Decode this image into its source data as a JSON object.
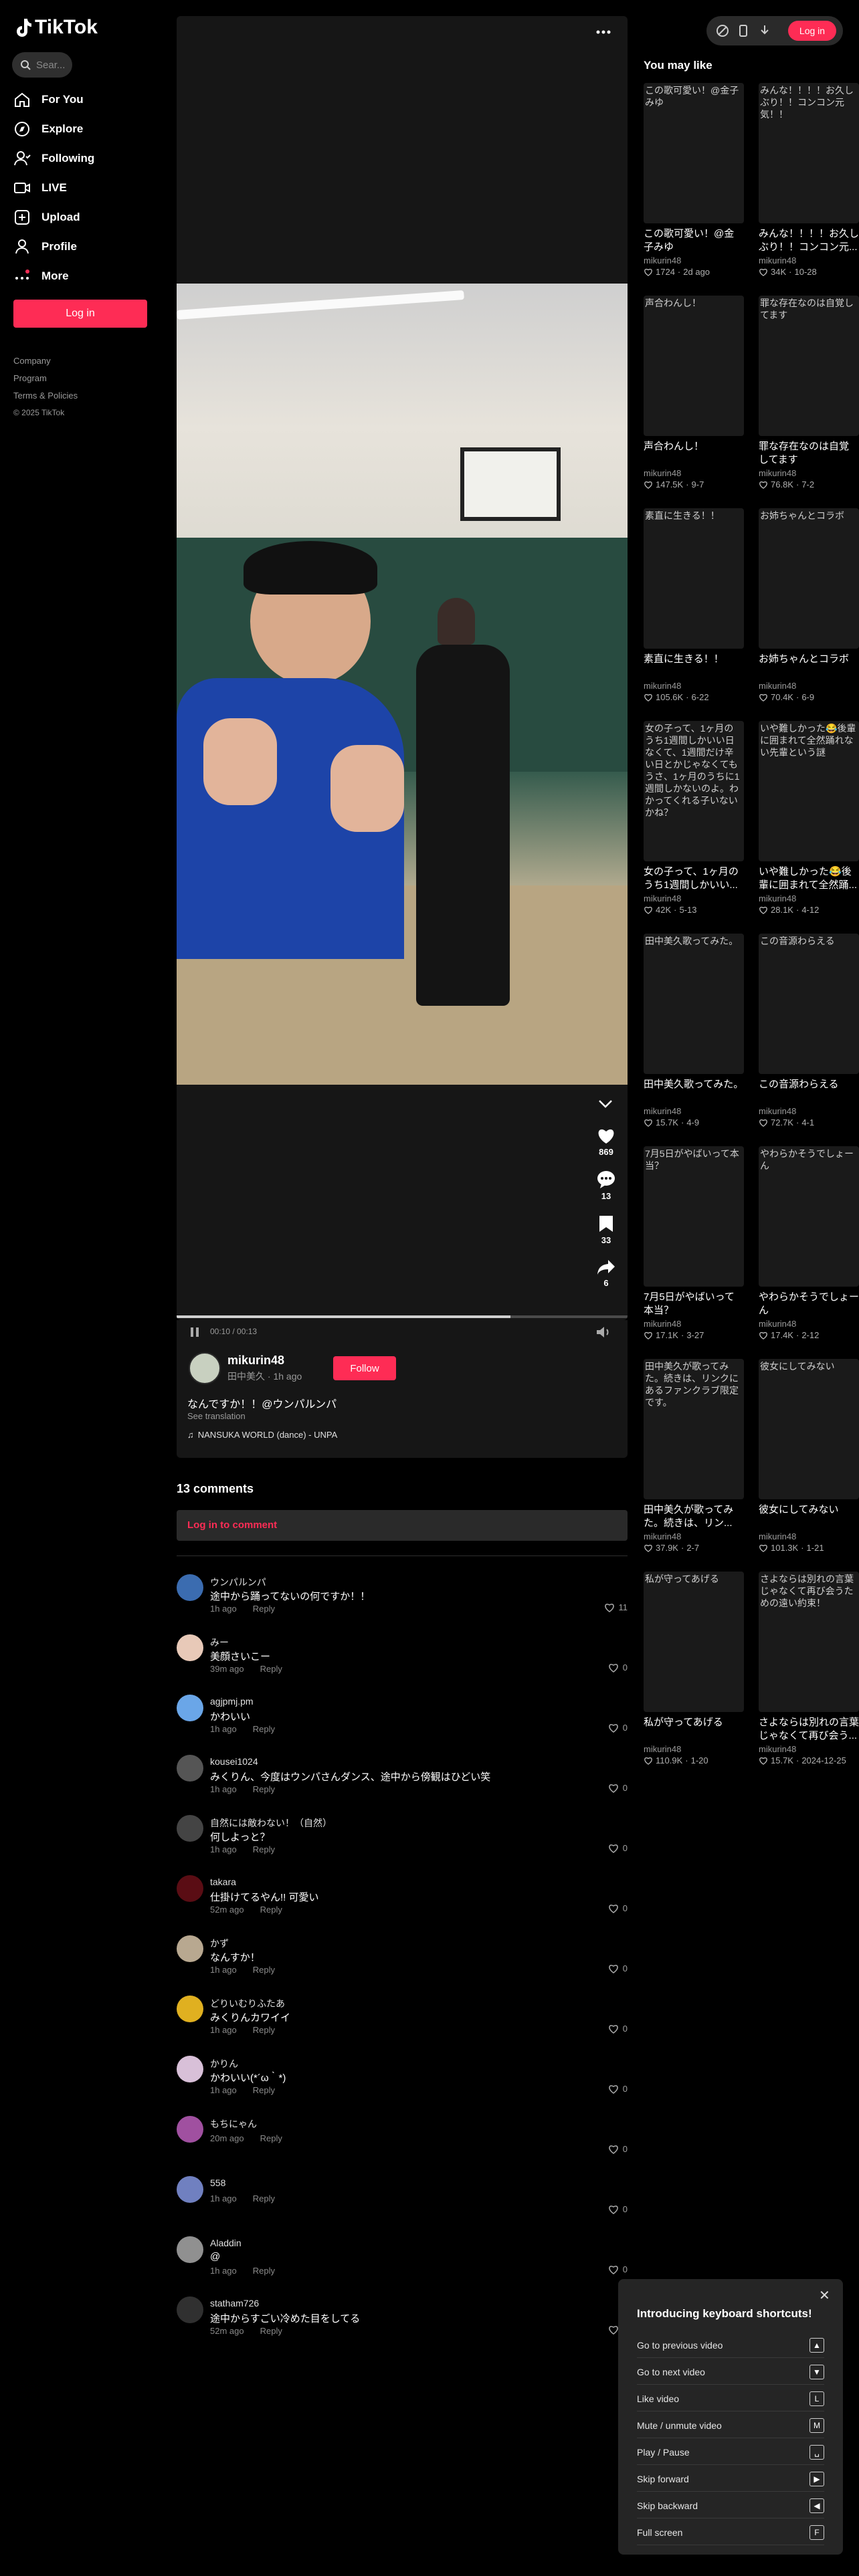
{
  "app": {
    "name": "TikTok"
  },
  "sidebar": {
    "search_placeholder": "Sear...",
    "items": [
      {
        "label": "For You",
        "icon": "home-icon"
      },
      {
        "label": "Explore",
        "icon": "compass-icon"
      },
      {
        "label": "Following",
        "icon": "following-icon"
      },
      {
        "label": "LIVE",
        "icon": "live-icon"
      },
      {
        "label": "Upload",
        "icon": "upload-icon"
      },
      {
        "label": "Profile",
        "icon": "profile-icon"
      },
      {
        "label": "More",
        "icon": "more-icon"
      }
    ],
    "login_label": "Log in",
    "footer": [
      "Company",
      "Program",
      "Terms & Policies",
      "© 2025 TikTok"
    ]
  },
  "topbar": {
    "login_label": "Log in"
  },
  "video": {
    "progress_time": "00:10 / 00:13",
    "progress_fraction": 0.74,
    "likes": "869",
    "comments_count": "13",
    "saves": "33",
    "shares": "6",
    "creator_name": "mikurin48",
    "creator_sub": "田中美久 · 1h ago",
    "follow_label": "Follow",
    "caption": "なんですか！！@ウンパルンパ",
    "see_translation": "See translation",
    "music": "NANSUKA WORLD (dance) - UNPA"
  },
  "comments": {
    "header": "13 comments",
    "login_prompt": "Log in to comment",
    "reply_label": "Reply",
    "items": [
      {
        "name": "ウンパルンパ",
        "text": "途中から踊ってないの何ですか！！",
        "time": "1h ago",
        "likes": "11",
        "avatar_color": "#3b6cb0"
      },
      {
        "name": "みー",
        "text": "美顔さいこー󠀠",
        "time": "39m ago",
        "likes": "0",
        "avatar_color": "#e8c9b8"
      },
      {
        "name": "agjpmj.pm",
        "text": "かわいい",
        "time": "1h ago",
        "likes": "0",
        "avatar_color": "#6aa6e8"
      },
      {
        "name": "kousei1024",
        "text": "みくりん、今度はウンパさんダンス、途中から傍観はひどい笑",
        "time": "1h ago",
        "likes": "0",
        "avatar_color": "#555"
      },
      {
        "name": "自然には敵わない！（自然）",
        "text": "何しよっと？",
        "time": "1h ago",
        "likes": "0",
        "avatar_color": "#444"
      },
      {
        "name": "takara",
        "text": "仕掛けてるやん!! 可愛い",
        "time": "52m ago",
        "likes": "0",
        "avatar_color": "#5a0d14"
      },
      {
        "name": "かず",
        "text": "なんすか！",
        "time": "1h ago",
        "likes": "0",
        "avatar_color": "#b8a890"
      },
      {
        "name": "どりいむりふたあ",
        "text": "みくりんカワイイ",
        "time": "1h ago",
        "likes": "0",
        "avatar_color": "#e0b020"
      },
      {
        "name": "かりん",
        "text": "かわいい(*´ω｀*)",
        "time": "1h ago",
        "likes": "0",
        "avatar_color": "#d8c0d8"
      },
      {
        "name": "もちにゃん",
        "text": "",
        "time": "20m ago",
        "likes": "0",
        "avatar_color": "#a050a0"
      },
      {
        "name": "558",
        "text": "",
        "time": "1h ago",
        "likes": "0",
        "avatar_color": "#7080c0"
      },
      {
        "name": "Aladdin",
        "text": "@",
        "time": "1h ago",
        "likes": "0",
        "avatar_color": "#909090"
      },
      {
        "name": "statham726",
        "text": "途中からすごい冷めた目をしてる",
        "time": "52m ago",
        "likes": "0",
        "avatar_color": "#303030"
      }
    ]
  },
  "you_may_like": {
    "heading": "You may like",
    "items": [
      {
        "thumb_text": "この歌可愛い！@金子みゆ",
        "title": "この歌可愛い！@金子みゆ",
        "user": "mikurin48",
        "likes": "1724",
        "date": "2d ago"
      },
      {
        "thumb_text": "みんな！！！！お久しぶり！！コンコン元気！！",
        "title": "みんな！！！！お久しぶり！！コンコン元...",
        "user": "mikurin48",
        "likes": "34K",
        "date": "10-28"
      },
      {
        "thumb_text": "声合わんし！",
        "title": "声合わんし！",
        "user": "mikurin48",
        "likes": "147.5K",
        "date": "9-7"
      },
      {
        "thumb_text": "罪な存在なのは自覚してます",
        "title": "罪な存在なのは自覚してます",
        "user": "mikurin48",
        "likes": "76.8K",
        "date": "7-2"
      },
      {
        "thumb_text": "素直に生きる！！",
        "title": "素直に生きる！！",
        "user": "mikurin48",
        "likes": "105.6K",
        "date": "6-22"
      },
      {
        "thumb_text": "お姉ちゃんとコラボ",
        "title": "お姉ちゃんとコラボ",
        "user": "mikurin48",
        "likes": "70.4K",
        "date": "6-9"
      },
      {
        "thumb_text": "女の子って、1ヶ月のうち1週間しかいい日なくて、1週間だけ辛い日とかじゃなくてもうさ、1ヶ月のうちに1週間しかないのよ。わかってくれる子いないかね？",
        "title": "女の子って、1ヶ月のうち1週間しかいい...",
        "user": "mikurin48",
        "likes": "42K",
        "date": "5-13"
      },
      {
        "thumb_text": "いや難しかった😂後輩に囲まれて全然踊れない先輩という謎",
        "title": "いや難しかった😂後輩に囲まれて全然踊...",
        "user": "mikurin48",
        "likes": "28.1K",
        "date": "4-12"
      },
      {
        "thumb_text": "田中美久歌ってみた。",
        "title": "田中美久歌ってみた。",
        "user": "mikurin48",
        "likes": "15.7K",
        "date": "4-9"
      },
      {
        "thumb_text": "この音源わらえる",
        "title": "この音源わらえる",
        "user": "mikurin48",
        "likes": "72.7K",
        "date": "4-1"
      },
      {
        "thumb_text": "7月5日がやばいって本当？",
        "title": "7月5日がやばいって本当？",
        "user": "mikurin48",
        "likes": "17.1K",
        "date": "3-27"
      },
      {
        "thumb_text": "やわらかそうでしょーん",
        "title": "やわらかそうでしょーん",
        "user": "mikurin48",
        "likes": "17.4K",
        "date": "2-12"
      },
      {
        "thumb_text": "田中美久が歌ってみた。続きは、リンクにあるファンクラブ限定です。",
        "title": "田中美久が歌ってみた。続きは、リン...",
        "user": "mikurin48",
        "likes": "37.9K",
        "date": "2-7"
      },
      {
        "thumb_text": "彼女にしてみない",
        "title": "彼女にしてみない",
        "user": "mikurin48",
        "likes": "101.3K",
        "date": "1-21"
      },
      {
        "thumb_text": "私が守ってあげる",
        "title": "私が守ってあげる",
        "user": "mikurin48",
        "likes": "110.9K",
        "date": "1-20"
      },
      {
        "thumb_text": "さよならは別れの言葉じゃなくて再び会うための遠い約束！",
        "title": "さよならは別れの言葉じゃなくて再び会う...",
        "user": "mikurin48",
        "likes": "15.7K",
        "date": "2024-12-25"
      }
    ]
  },
  "shortcuts": {
    "title": "Introducing keyboard shortcuts!",
    "rows": [
      {
        "label": "Go to previous video",
        "key": "▲"
      },
      {
        "label": "Go to next video",
        "key": "▼"
      },
      {
        "label": "Like video",
        "key": "L"
      },
      {
        "label": "Mute / unmute video",
        "key": "M"
      },
      {
        "label": "Play / Pause",
        "key": "␣"
      },
      {
        "label": "Skip forward",
        "key": "▶"
      },
      {
        "label": "Skip backward",
        "key": "◀"
      },
      {
        "label": "Full screen",
        "key": "F"
      }
    ]
  },
  "colors": {
    "accent": "#fe2c55",
    "bg": "#000000",
    "panel": "#161616"
  }
}
